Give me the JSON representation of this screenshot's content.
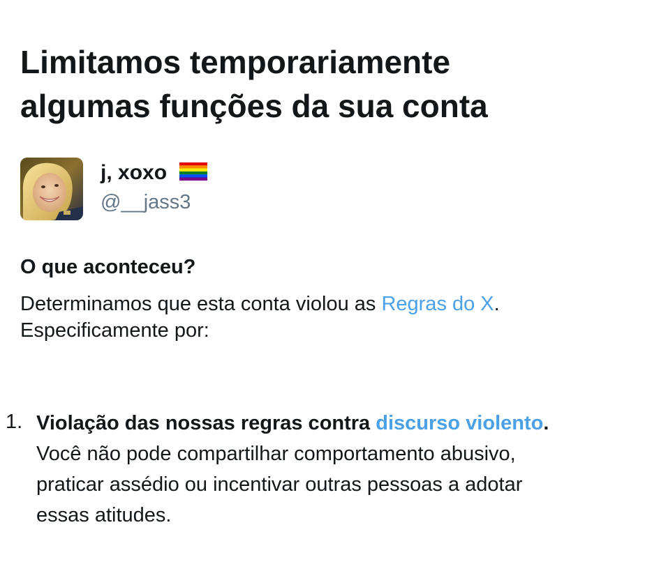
{
  "header": {
    "title_line1": "Limitamos temporariamente",
    "title_line2": "algumas funções da sua conta"
  },
  "account": {
    "display_name": "j, xoxo",
    "handle": "@__jass3",
    "flag_icon": "rainbow-flag-icon",
    "avatar_icon": "profile-photo"
  },
  "details": {
    "heading": "O que aconteceu?",
    "text_before_link": "Determinamos que esta conta violou as ",
    "rules_link": "Regras do X",
    "text_after_link": ".",
    "line2": "Especificamente por:"
  },
  "violations": [
    {
      "number": "1.",
      "heading_before_link": "Violação das nossas regras contra ",
      "heading_link": "discurso violento",
      "heading_after_link": ".",
      "line1": "Você não pode compartilhar comportamento abusivo,",
      "line2": "praticar assédio ou incentivar outras pessoas a adotar",
      "line3": "essas atitudes."
    }
  ],
  "colors": {
    "text": "#14171a",
    "secondary_text": "#657786",
    "link": "#4aa1e8",
    "background": "#ffffff"
  }
}
